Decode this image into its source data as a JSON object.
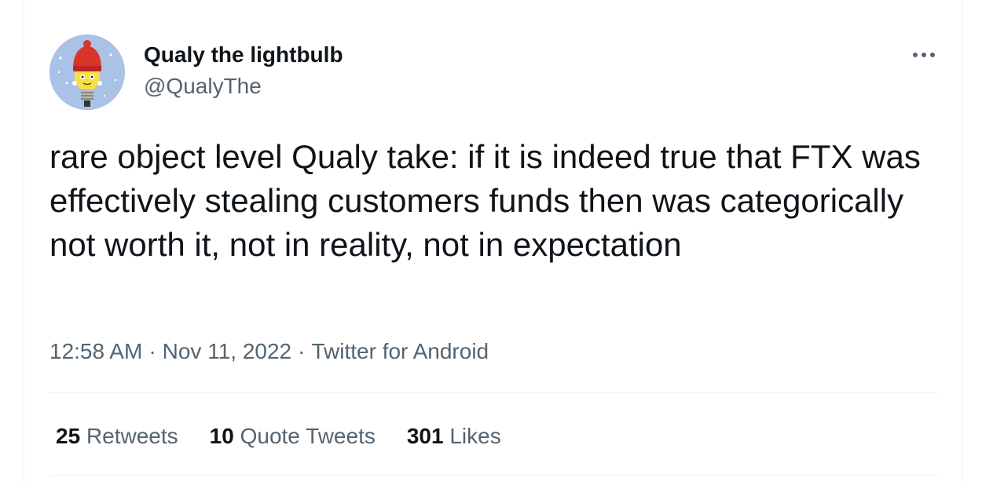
{
  "author": {
    "name": "Qualy the lightbulb",
    "handle": "@QualyThe"
  },
  "tweet": {
    "text": "rare object level Qualy take: if it is indeed true that FTX was effectively stealing customers funds then was categorically not worth it, not in reality, not in expectation"
  },
  "meta": {
    "time": "12:58 AM",
    "separator": "·",
    "date": "Nov 11, 2022",
    "source": "Twitter for Android"
  },
  "stats": {
    "retweets_count": "25",
    "retweets_label": "Retweets",
    "quotes_count": "10",
    "quotes_label": "Quote Tweets",
    "likes_count": "301",
    "likes_label": "Likes"
  },
  "icons": {
    "more": "more-horizontal-icon"
  },
  "colors": {
    "text_primary": "#0f1419",
    "text_secondary": "#536471",
    "divider": "#eff3f4",
    "avatar_bg": "#a9c2e6",
    "hat_red": "#d8342a"
  }
}
